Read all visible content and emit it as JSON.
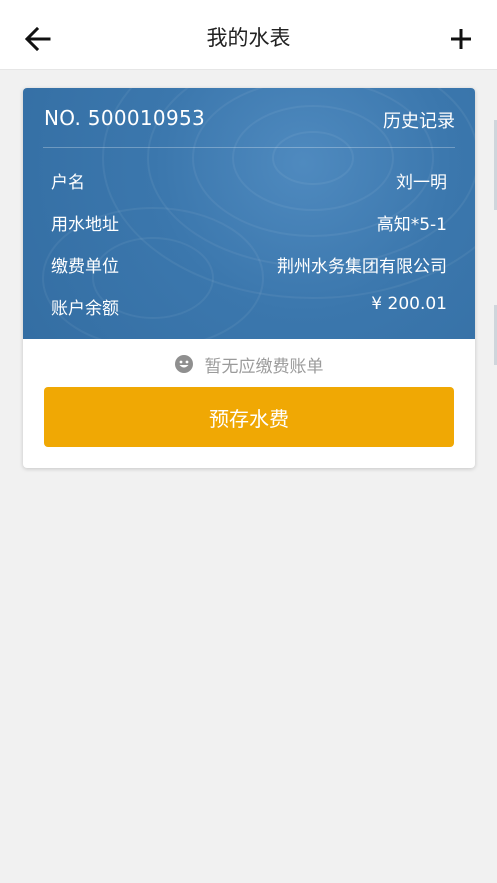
{
  "header": {
    "title": "我的水表",
    "back_icon": "arrow-left-icon",
    "add_icon": "plus-icon"
  },
  "meter": {
    "number_label": "NO. 500010953",
    "history_label": "历史记录",
    "rows": [
      {
        "key": "户名",
        "value": "刘一明"
      },
      {
        "key": "用水地址",
        "value": "高知*5-1"
      },
      {
        "key": "缴费单位",
        "value": "荆州水务集团有限公司"
      },
      {
        "key": "账户余额",
        "value": "¥ 200.01"
      }
    ]
  },
  "status": {
    "empty_text": "暂无应缴费账单",
    "icon": "smile-icon"
  },
  "actions": {
    "prepay_label": "预存水费"
  },
  "colors": {
    "card_blue": "#3b77ad",
    "button_orange": "#f0a804",
    "background": "#f1f1f1"
  }
}
